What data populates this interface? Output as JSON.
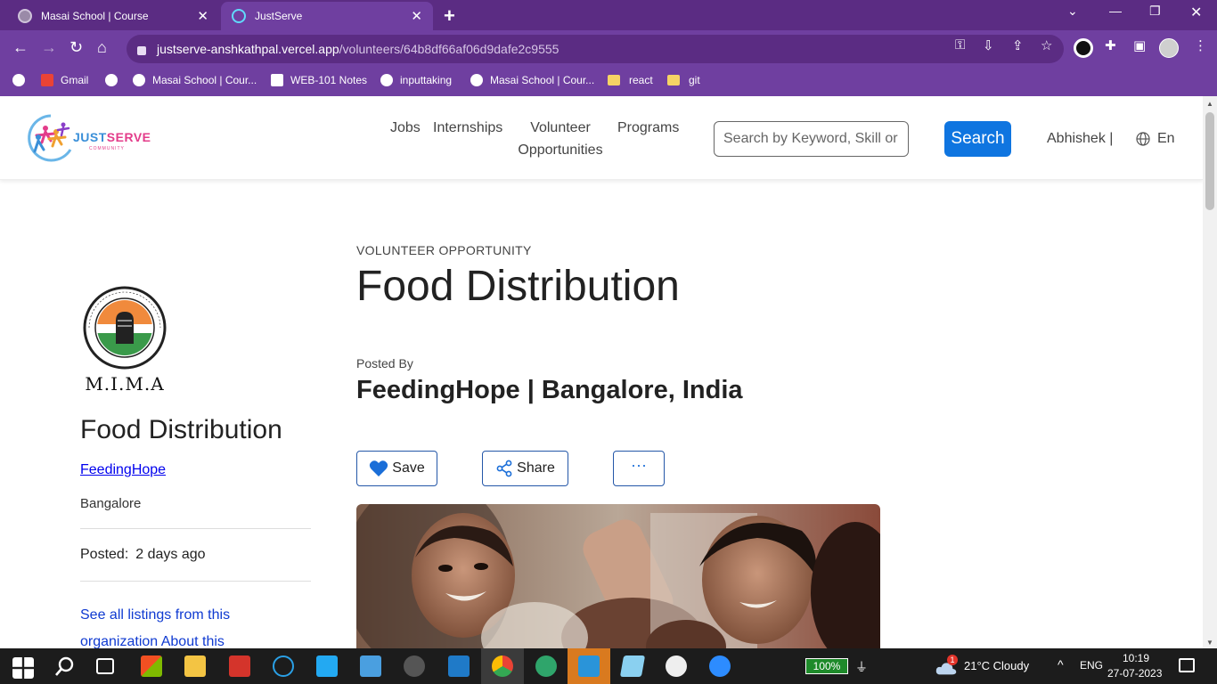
{
  "browser": {
    "tabs": [
      {
        "title": "Masai School | Course",
        "active": false
      },
      {
        "title": "JustServe",
        "active": true
      }
    ],
    "url_host": "justserve-anshkathpal.vercel.app",
    "url_path": "/volunteers/64b8df66af06d9dafe2c9555",
    "bookmarks": [
      {
        "label": "Gmail",
        "icon": "gmail-icon"
      },
      {
        "label": "Masai School | Cour...",
        "icon": "globe-icon"
      },
      {
        "label": "WEB-101 Notes",
        "icon": "notion-icon"
      },
      {
        "label": "inputtaking",
        "icon": "globe-icon"
      },
      {
        "label": "Masai School | Cour...",
        "icon": "globe-icon"
      },
      {
        "label": "react",
        "icon": "folder-icon"
      },
      {
        "label": "git",
        "icon": "folder-icon"
      }
    ]
  },
  "site": {
    "brand_just": "JUST",
    "brand_serve": "SERVE",
    "brand_sub": "COMMUNITY",
    "nav": {
      "jobs": "Jobs",
      "internships": "Internships",
      "volunteer_line1": "Volunteer",
      "volunteer_line2": "Opportunities",
      "programs": "Programs"
    },
    "search_placeholder": "Search by Keyword, Skill or I",
    "search_button": "Search",
    "user": "Abhishek  |",
    "lang": "En"
  },
  "sidebar": {
    "org_logo_text": "M.I.M.A",
    "title": "Food Distribution",
    "org": "FeedingHope",
    "location": "Bangalore",
    "posted_label": "Posted:",
    "posted_value": "2 days ago",
    "see_all": "See all listings from this organization About this"
  },
  "main": {
    "eyebrow": "VOLUNTEER OPPORTUNITY",
    "title": "Food Distribution",
    "posted_by_label": "Posted By",
    "posted_by": "FeedingHope | Bangalore, India",
    "save": "Save",
    "share": "Share",
    "more": "···"
  },
  "taskbar": {
    "battery": "100%",
    "weather": "21°C  Cloudy",
    "weather_badge": "1",
    "lang": "ENG",
    "time": "10:19",
    "date": "27-07-2023"
  },
  "colors": {
    "chrome_dark": "#5b2c83",
    "chrome_light": "#6f3fa0",
    "search_button": "#0f75e0",
    "link": "#0000ee"
  }
}
